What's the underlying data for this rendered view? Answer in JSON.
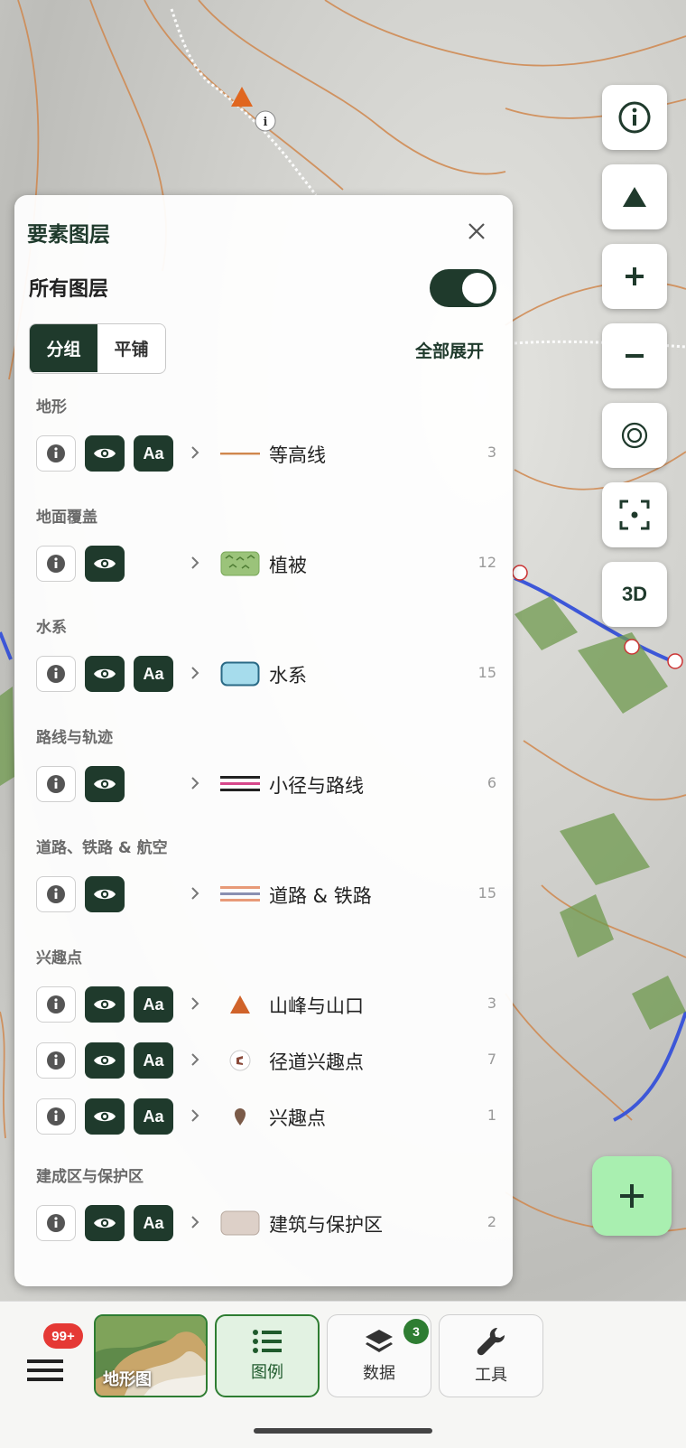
{
  "panel": {
    "title": "要素图层",
    "all_layers_label": "所有图层",
    "all_layers_on": true,
    "view_modes": [
      "分组",
      "平铺"
    ],
    "active_view_mode": "分组",
    "expand_all_label": "全部展开"
  },
  "sections": [
    {
      "title": "地形",
      "layers": [
        {
          "name": "等高线",
          "count": "3",
          "label_toggle": "Aa"
        }
      ]
    },
    {
      "title": "地面覆盖",
      "layers": [
        {
          "name": "植被",
          "count": "12"
        }
      ]
    },
    {
      "title": "水系",
      "layers": [
        {
          "name": "水系",
          "count": "15",
          "label_toggle": "Aa"
        }
      ]
    },
    {
      "title": "路线与轨迹",
      "layers": [
        {
          "name": "小径与路线",
          "count": "6"
        }
      ]
    },
    {
      "title": "道路、铁路 & 航空",
      "layers": [
        {
          "name": "道路 & 铁路",
          "count": "15"
        }
      ]
    },
    {
      "title": "兴趣点",
      "layers": [
        {
          "name": "山峰与山口",
          "count": "3",
          "label_toggle": "Aa"
        },
        {
          "name": "径道兴趣点",
          "count": "7",
          "label_toggle": "Aa"
        },
        {
          "name": "兴趣点",
          "count": "1",
          "label_toggle": "Aa"
        }
      ]
    },
    {
      "title": "建成区与保护区",
      "layers": [
        {
          "name": "建筑与保护区",
          "count": "2",
          "label_toggle": "Aa"
        }
      ]
    }
  ],
  "map_controls": {
    "three_d_label": "3D"
  },
  "bottom_bar": {
    "menu_badge": "99+",
    "basemap_label": "地形图",
    "tabs": [
      {
        "label": "图例",
        "icon": "list-icon",
        "active": true
      },
      {
        "label": "数据",
        "icon": "layers-icon",
        "badge": "3"
      },
      {
        "label": "工具",
        "icon": "wrench-icon"
      }
    ]
  },
  "colors": {
    "accent": "#1f3a2c",
    "active_green": "#2e7d32",
    "fab": "#a9efb0",
    "badge_red": "#e53935"
  }
}
